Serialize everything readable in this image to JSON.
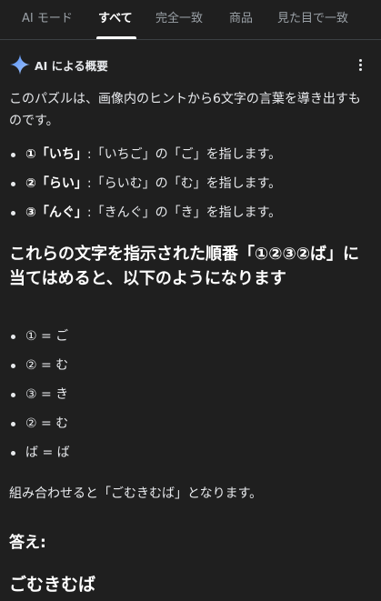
{
  "tabs": [
    {
      "label": "AI モード",
      "active": false
    },
    {
      "label": "すべて",
      "active": true
    },
    {
      "label": "完全一致",
      "active": false
    },
    {
      "label": "商品",
      "active": false
    },
    {
      "label": "見た目で一致",
      "active": false
    }
  ],
  "ai_overview": {
    "title": "AI による概要",
    "icon": "sparkle-icon",
    "menu_icon": "more-vert-icon"
  },
  "intro": "このパズルは、画像内のヒントから6文字の言葉を導き出すものです。",
  "hints": [
    {
      "label": "①「いち」",
      "text": ":「いちご」の「ご」を指します。"
    },
    {
      "label": "②「らい」",
      "text": ":「らいむ」の「む」を指します。"
    },
    {
      "label": "③「んぐ」",
      "text": ":「きんぐ」の「き」を指します。"
    }
  ],
  "heading": "これらの文字を指示された順番「①②③②ば」に当てはめると、以下のようになります",
  "mapping": [
    "① = ご",
    "② = む",
    "③ = き",
    "② = む",
    "ば = ば"
  ],
  "combine_text": "組み合わせると「ごむきむば」となります。",
  "answer_label": "答え:",
  "answer_value": "ごむきむば",
  "colors": {
    "background": "#1f1f1f",
    "text": "#e8eaed",
    "muted": "#9aa0a6",
    "sparkle_blue": "#8ab4f8"
  }
}
